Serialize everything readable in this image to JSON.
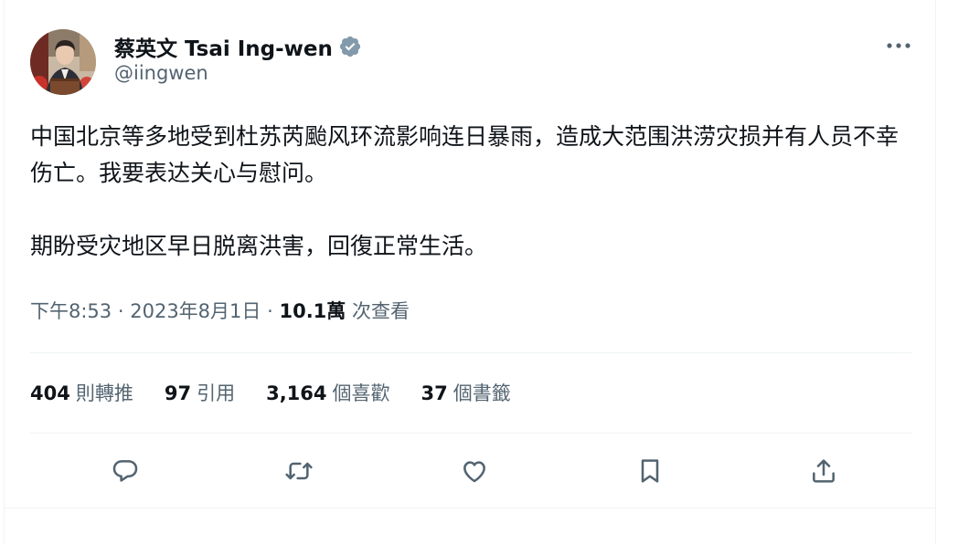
{
  "author": {
    "display_name": "蔡英文 Tsai Ing-wen",
    "handle": "@iingwen",
    "verified": true,
    "verified_badge_color": "#829aab",
    "avatar": "avatar-photo"
  },
  "tweet": {
    "paragraphs": [
      "中国北京等多地受到杜苏芮颱风环流影响连日暴雨，造成大范围洪涝灾损并有人员不幸伤亡。我要表达关心与慰问。",
      "期盼受灾地区早日脱离洪害，回復正常生活。"
    ],
    "time": "下午8:53",
    "date": "2023年8月1日",
    "separator": "·",
    "views_count": "10.1萬",
    "views_label": "次查看"
  },
  "stats": [
    {
      "count": "404",
      "label": "則轉推"
    },
    {
      "count": "97",
      "label": "引用"
    },
    {
      "count": "3,164",
      "label": "個喜歡"
    },
    {
      "count": "37",
      "label": "個書籤"
    }
  ],
  "actions": [
    {
      "name": "reply",
      "icon": "reply-icon"
    },
    {
      "name": "retweet",
      "icon": "retweet-icon"
    },
    {
      "name": "like",
      "icon": "heart-icon"
    },
    {
      "name": "bookmark",
      "icon": "bookmark-icon"
    },
    {
      "name": "share",
      "icon": "share-icon"
    }
  ],
  "colors": {
    "text_primary": "#0f1419",
    "text_secondary": "#536471",
    "border": "#eff3f4"
  }
}
